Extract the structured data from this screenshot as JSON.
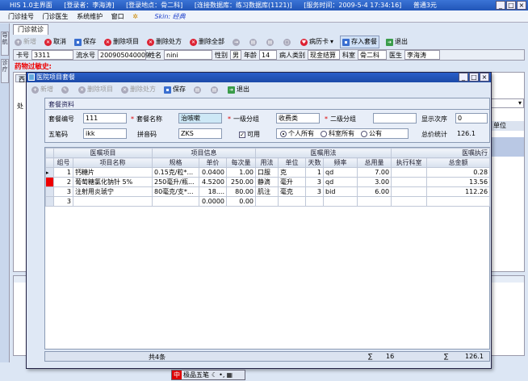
{
  "window": {
    "title_parts": [
      "HIS 1.0主界面",
      "[登录者：李海涛]",
      "[登录地点：骨二科]",
      "[连接数据库：练习数据库(1121)]",
      "[服务时间：2009-5-4 17:34:16]",
      "普通3元"
    ],
    "controls": [
      "_",
      "□",
      "×"
    ]
  },
  "menu": {
    "items": [
      "门诊挂号",
      "门诊医生",
      "系统维护",
      "窗口"
    ],
    "skin": "Skin: 经典"
  },
  "sidebar": {
    "tabs": [
      "导航",
      "诊疗"
    ]
  },
  "outer": {
    "tab": "门诊就诊",
    "toolbar": [
      "新增",
      "取消",
      "保存",
      "删除项目",
      "删除处方",
      "删除全部",
      "",
      "",
      " ",
      "",
      "病历卡",
      "存入套餐",
      "退出"
    ],
    "patient": {
      "card_label": "卡号",
      "card": "3311",
      "serial_label": "流水号",
      "serial": "200905040009",
      "name_label": "姓名",
      "name": "nini",
      "sex_label": "性别",
      "sex": "男",
      "age_label": "年龄",
      "age": "14",
      "ptype_label": "病人类别",
      "ptype": "现金结算",
      "dept_label": "科室",
      "dept": "骨二科",
      "doctor_label": "医生",
      "doctor": "李海涛"
    },
    "allergy": "药物过敏史:",
    "right_col": "单位",
    "left_tab": "西",
    "left_label": "处"
  },
  "dialog": {
    "title": "医院项目套餐",
    "controls": [
      "_",
      "□",
      "×"
    ],
    "toolbar": [
      "新增",
      "",
      "删除项目",
      "删除处方",
      "保存",
      "",
      "",
      "退出"
    ],
    "section": "套餐资料",
    "form": {
      "code_label": "套餐编号",
      "code": "111",
      "name_label": "套餐名称",
      "name": "治咳嗽",
      "g1_label": "一级分组",
      "g1": "收费类",
      "g2_label": "二级分组",
      "g2": "",
      "order_label": "显示次序",
      "order": "0",
      "wubi_label": "五笔码",
      "wubi": "ikk",
      "pinyin_label": "拼音码",
      "pinyin": "ZKS",
      "usable": "可用",
      "owner_opts": [
        "个人所有",
        "科室所有",
        "公有"
      ],
      "total_label": "总价统计",
      "total": "126.1"
    },
    "grid": {
      "groups": [
        "医嘱项目",
        "项目信息",
        "医嘱用法",
        "医嘱执行"
      ],
      "columns": [
        "组号",
        "项目名称",
        "规格",
        "单价",
        "每次量",
        "用法",
        "单位",
        "天数",
        "频率",
        "总用量",
        "执行科室",
        "总金额"
      ],
      "rows": [
        {
          "group": "1",
          "name": "钙糖片",
          "spec": "0.15克/粒*...",
          "price": "0.0400",
          "dose": "1.00",
          "usage": "口服",
          "unit": "克",
          "days": "1",
          "freq": "qd",
          "qty": "7.00",
          "dept": "",
          "amount": "0.28"
        },
        {
          "group": "2",
          "name": "葡萄糖氯化钠针 5%",
          "spec": "250毫升/瓶...",
          "price": "4.5200",
          "dose": "250.00",
          "usage": "静滴",
          "unit": "毫升",
          "days": "3",
          "freq": "qd",
          "qty": "3.00",
          "dept": "",
          "amount": "13.56"
        },
        {
          "group": "3",
          "name": "注射用炎琥宁",
          "spec": "80毫克/支*...",
          "price": "18....",
          "dose": "80.00",
          "usage": "肌注",
          "unit": "毫克",
          "days": "3",
          "freq": "bid",
          "qty": "6.00",
          "dept": "",
          "amount": "112.26"
        },
        {
          "group": "3",
          "name": "",
          "spec": "",
          "price": "0.0000",
          "dose": "0.00",
          "usage": "",
          "unit": "",
          "days": "",
          "freq": "",
          "qty": "",
          "dept": "",
          "amount": ""
        }
      ]
    },
    "status": {
      "count": "共4条",
      "sum_days": "16",
      "sum_amount": "126.1"
    }
  },
  "ime": {
    "label": "极品五笔",
    "logo": "中"
  },
  "colors": {
    "accent": "#2a5fc9",
    "allergy": "#e00000",
    "grid_header": "#d7e0ee"
  }
}
